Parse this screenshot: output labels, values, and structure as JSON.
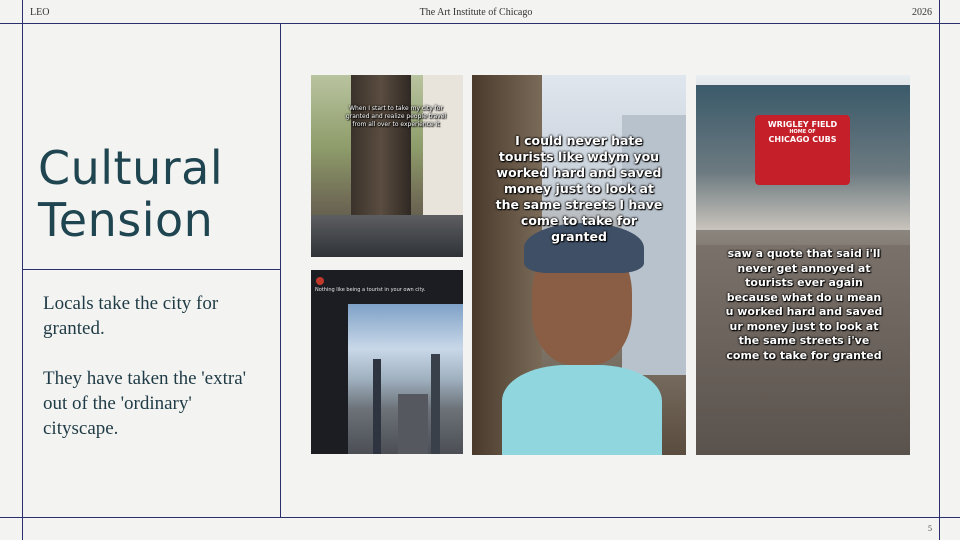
{
  "header": {
    "left": "LEO",
    "center": "The Art Institute of Chicago",
    "right": "2026"
  },
  "title": {
    "line1": "Cultural",
    "line2": "Tension"
  },
  "body": {
    "para1": "Locals take the city for granted.",
    "para2": "They have taken the 'extra' out of the 'ordinary' cityscape."
  },
  "photos": {
    "tree": {
      "caption": "When I start to take my city for granted and realize people travel from all over to experience it"
    },
    "skyline": {
      "post_text": "Nothing like being a tourist in your own city."
    },
    "selfie": {
      "caption": "I could never hate tourists like wdym you worked hard and saved money just to look at the same streets I have come to take for granted"
    },
    "wrigley": {
      "sign_line1": "WRIGLEY FIELD",
      "sign_line2": "HOME OF",
      "sign_line3": "CHICAGO CUBS",
      "caption": "saw a quote that said i'll never get annoyed at tourists ever again because what do u mean u worked hard and saved ur money just to look at the same streets i've come to take for granted"
    }
  },
  "page_number": "5"
}
